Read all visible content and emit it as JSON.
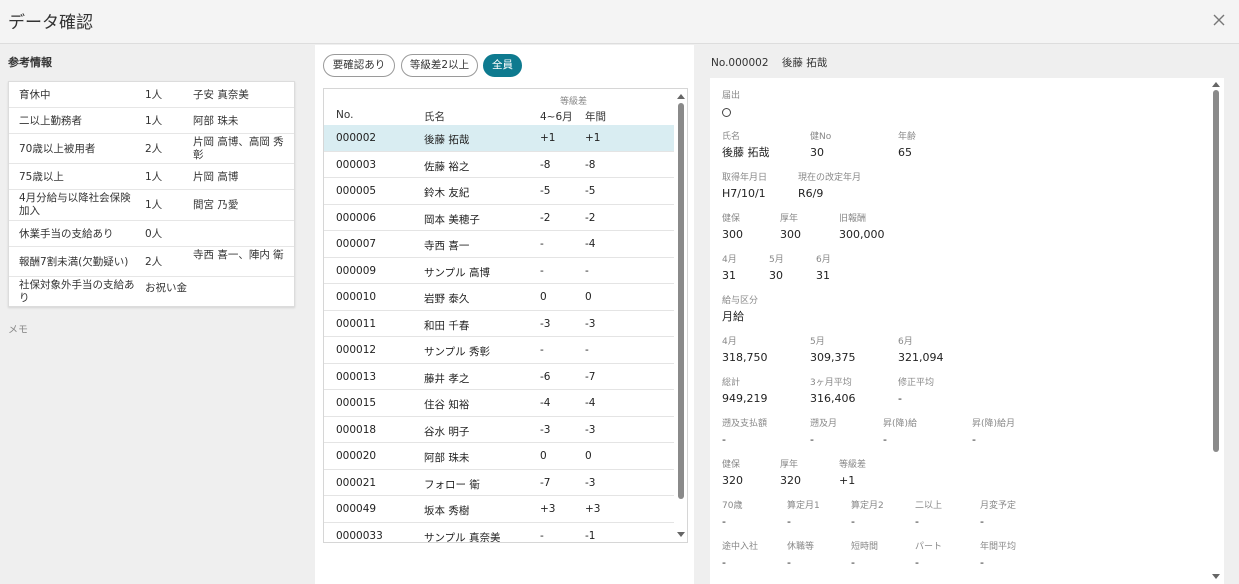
{
  "window": {
    "title": "データ確認",
    "close_icon": "close-icon"
  },
  "reference": {
    "heading": "参考情報",
    "memo_label": "メモ",
    "rows": [
      {
        "label": "育休中",
        "count": "1人",
        "names": "子安 真奈美"
      },
      {
        "label": "二以上勤務者",
        "count": "1人",
        "names": "阿部 珠未"
      },
      {
        "label": "70歳以上被用者",
        "count": "2人",
        "names": "片岡 高博、高岡 秀彰"
      },
      {
        "label": "75歳以上",
        "count": "1人",
        "names": "片岡 高博"
      },
      {
        "label": "4月分給与以降社会保険加入",
        "count": "1人",
        "names": "間宮 乃愛"
      },
      {
        "label": "休業手当の支給あり",
        "count": "0人",
        "names": ""
      },
      {
        "label": "報酬7割未満(欠勤疑い)",
        "count": "2人",
        "names": "寺西 喜一、陣内 衛"
      },
      {
        "label": "社保対象外手当の支給あり",
        "count": "お祝い金",
        "names": ""
      }
    ]
  },
  "filters": [
    {
      "label": "要確認あり",
      "active": false
    },
    {
      "label": "等級差2以上",
      "active": false
    },
    {
      "label": "全員",
      "active": true
    }
  ],
  "list": {
    "group_header": "等級差",
    "headers": {
      "no": "No.",
      "name": "氏名",
      "apr_jun": "4~6月",
      "annual": "年間"
    },
    "rows": [
      {
        "no": "000002",
        "name": "後藤 拓哉",
        "apr_jun": "+1",
        "annual": "+1",
        "selected": true
      },
      {
        "no": "000003",
        "name": "佐藤 裕之",
        "apr_jun": "-8",
        "annual": "-8"
      },
      {
        "no": "000005",
        "name": "鈴木 友紀",
        "apr_jun": "-5",
        "annual": "-5"
      },
      {
        "no": "000006",
        "name": "岡本 美穂子",
        "apr_jun": "-2",
        "annual": "-2"
      },
      {
        "no": "000007",
        "name": "寺西 喜一",
        "apr_jun": "-",
        "annual": "-4"
      },
      {
        "no": "000009",
        "name": "サンプル 高博",
        "apr_jun": "-",
        "annual": "-"
      },
      {
        "no": "000010",
        "name": "岩野 泰久",
        "apr_jun": "0",
        "annual": "0"
      },
      {
        "no": "000011",
        "name": "和田 千春",
        "apr_jun": "-3",
        "annual": "-3"
      },
      {
        "no": "000012",
        "name": "サンプル 秀彰",
        "apr_jun": "-",
        "annual": "-"
      },
      {
        "no": "000013",
        "name": "藤井 孝之",
        "apr_jun": "-6",
        "annual": "-7"
      },
      {
        "no": "000015",
        "name": "住谷 知裕",
        "apr_jun": "-4",
        "annual": "-4"
      },
      {
        "no": "000018",
        "name": "谷水 明子",
        "apr_jun": "-3",
        "annual": "-3"
      },
      {
        "no": "000020",
        "name": "阿部 珠未",
        "apr_jun": "0",
        "annual": "0"
      },
      {
        "no": "000021",
        "name": "フォロー 衛",
        "apr_jun": "-7",
        "annual": "-3"
      },
      {
        "no": "000049",
        "name": "坂本 秀樹",
        "apr_jun": "+3",
        "annual": "+3"
      },
      {
        "no": "0000033",
        "name": "サンプル 真奈美",
        "apr_jun": "-",
        "annual": "-1"
      }
    ]
  },
  "detail": {
    "header_no": "No.000002",
    "header_name": "後藤 拓哉",
    "notification": {
      "label": "届出",
      "value": "○"
    },
    "name": {
      "label": "氏名",
      "value": "後藤 拓哉"
    },
    "kenpo_no": {
      "label": "健No",
      "value": "30"
    },
    "age": {
      "label": "年齢",
      "value": "65"
    },
    "acquired": {
      "label": "取得年月日",
      "value": "H7/10/1"
    },
    "current_revision": {
      "label": "現在の改定年月",
      "value": "R6/9"
    },
    "std1": {
      "kenpo_label": "健保",
      "kenpo": "300",
      "kousei_label": "厚年",
      "kousei": "300",
      "old_label": "旧報酬",
      "old": "300,000"
    },
    "days": {
      "apr_label": "4月",
      "apr": "31",
      "may_label": "5月",
      "may": "30",
      "jun_label": "6月",
      "jun": "31"
    },
    "pay_type": {
      "label": "給与区分",
      "value": "月給"
    },
    "pay": {
      "apr_label": "4月",
      "apr": "318,750",
      "may_label": "5月",
      "may": "309,375",
      "jun_label": "6月",
      "jun": "321,094"
    },
    "totals": {
      "total_label": "総計",
      "total": "949,219",
      "avg_label": "3ヶ月平均",
      "avg": "316,406",
      "fix_label": "修正平均",
      "fix": "-"
    },
    "retro": {
      "pay_label": "遡及支払額",
      "pay": "-",
      "month_label": "遡及月",
      "month": "-",
      "raise_label": "昇(降)給",
      "raise": "-",
      "raise_month_label": "昇(降)給月",
      "raise_month": "-"
    },
    "std2": {
      "kenpo_label": "健保",
      "kenpo": "320",
      "kousei_label": "厚年",
      "kousei": "320",
      "diff_label": "等級差",
      "diff": "+1"
    },
    "flags1": {
      "a_label": "70歳",
      "a": "-",
      "b_label": "算定月1",
      "b": "-",
      "c_label": "算定月2",
      "c": "-",
      "d_label": "二以上",
      "d": "-",
      "e_label": "月変予定",
      "e": "-"
    },
    "flags2": {
      "a_label": "途中入社",
      "a": "-",
      "b_label": "休職等",
      "b": "-",
      "c_label": "短時間",
      "c": "-",
      "d_label": "パート",
      "d": "-",
      "e_label": "年間平均",
      "e": "-"
    }
  }
}
